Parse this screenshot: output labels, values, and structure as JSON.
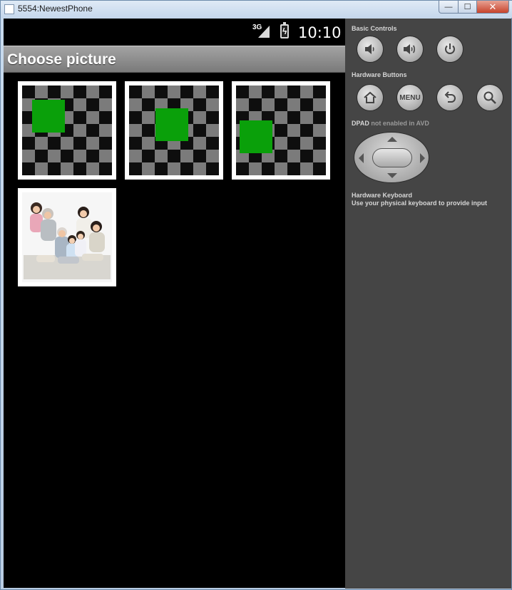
{
  "window": {
    "title": "5554:NewestPhone",
    "controls": {
      "minimize": "—",
      "maximize": "☐",
      "close": "✕"
    }
  },
  "statusbar": {
    "network": "3G",
    "time": "10:10"
  },
  "actionbar": {
    "title": "Choose picture"
  },
  "gallery": {
    "items": [
      {
        "type": "checkerboard",
        "accent": "#0aa00a"
      },
      {
        "type": "checkerboard",
        "accent": "#0aa00a"
      },
      {
        "type": "checkerboard",
        "accent": "#0aa00a"
      },
      {
        "type": "photo"
      }
    ]
  },
  "panel": {
    "basic_controls_label": "Basic Controls",
    "hardware_buttons_label": "Hardware Buttons",
    "menu_label": "MENU",
    "dpad_label_strong": "DPAD",
    "dpad_label_rest": "not enabled in AVD",
    "keyboard_label": "Hardware Keyboard",
    "keyboard_hint": "Use your physical keyboard to provide input"
  },
  "colors": {
    "panel_bg": "#454545",
    "screen_bg": "#000000",
    "actionbar_bg": "#8c8c8c",
    "accent_green": "#0aa00a"
  }
}
